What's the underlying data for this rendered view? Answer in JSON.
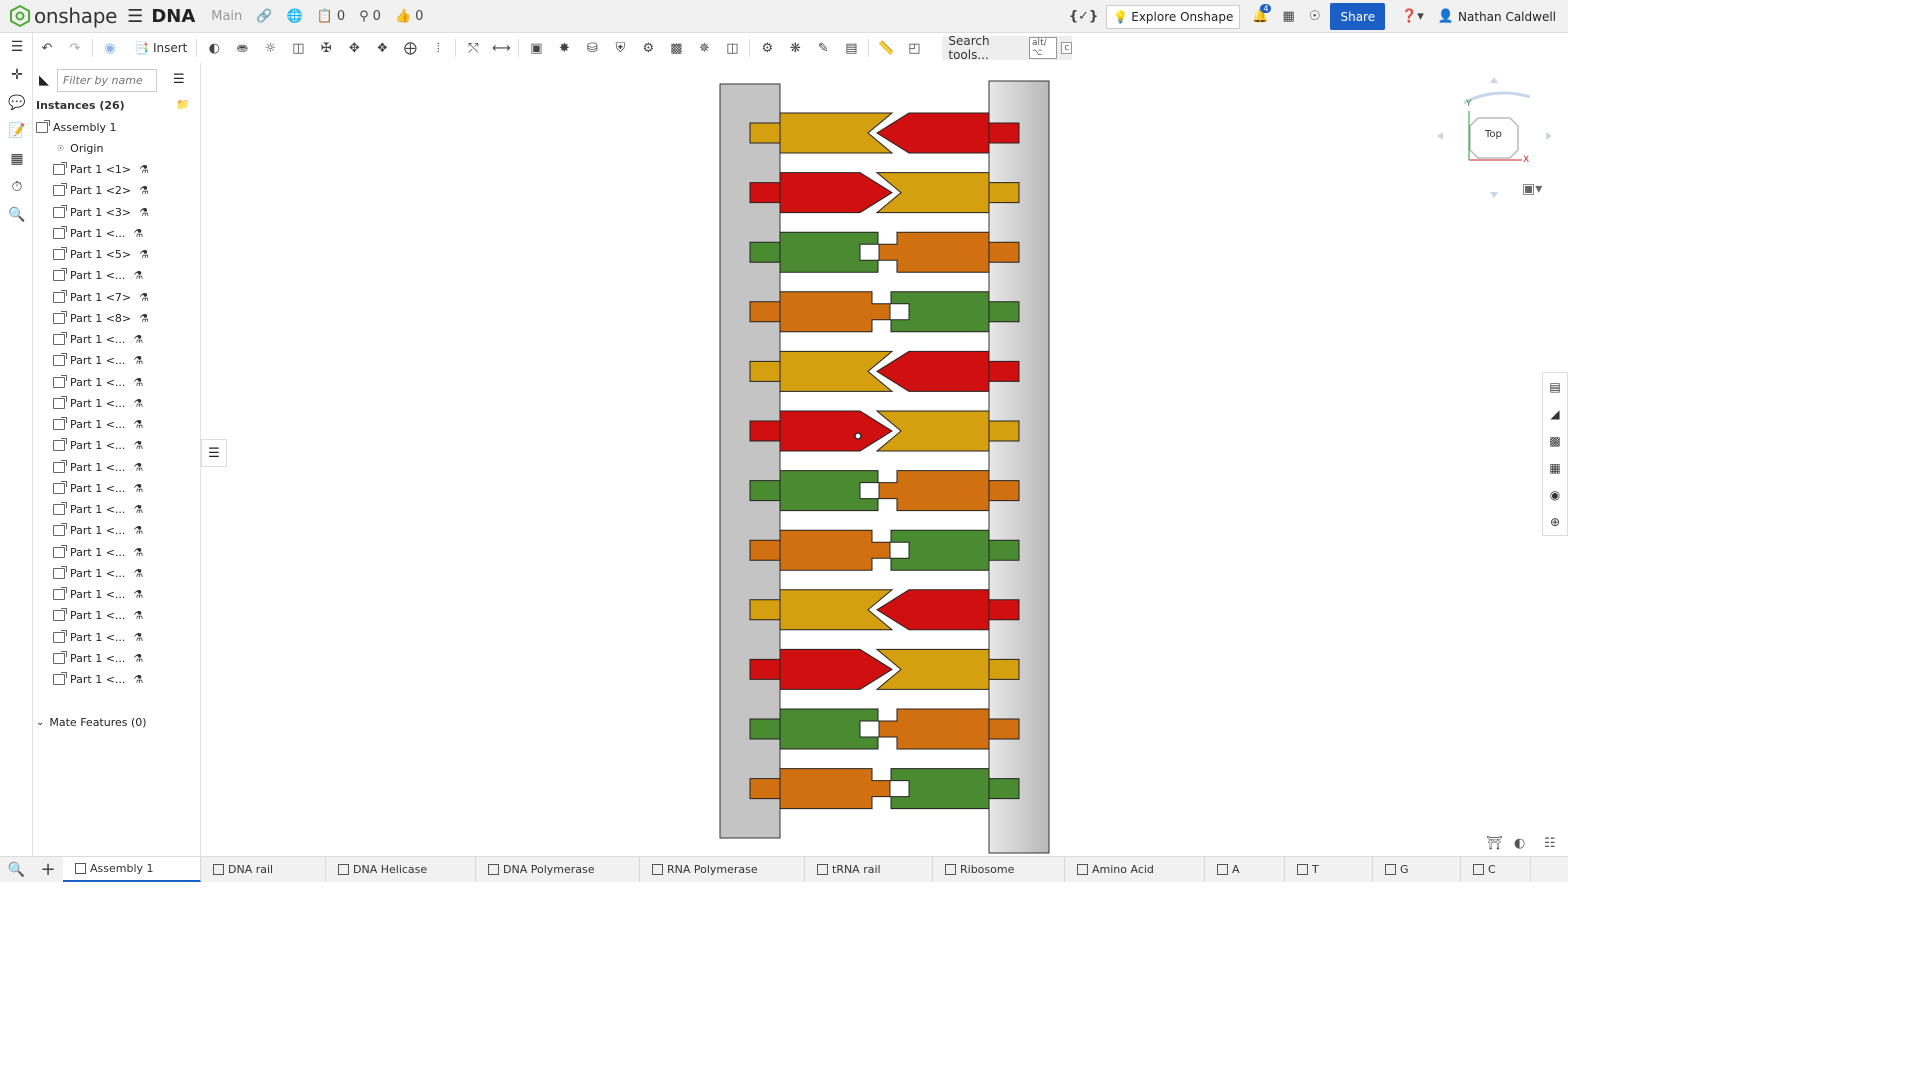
{
  "header": {
    "brand": "onshape",
    "doc_title": "DNA",
    "branch": "Main",
    "counter_docs": "0",
    "counter_versions": "0",
    "counter_likes": "0",
    "explore_label": "Explore Onshape",
    "notification_count": "4",
    "share_label": "Share",
    "user_name": "Nathan Caldwell"
  },
  "toolbar": {
    "insert_label": "Insert",
    "search_label": "Search tools...",
    "search_shortcut_a": "alt/⌥",
    "search_shortcut_b": "c"
  },
  "panel": {
    "filter_placeholder": "Filter by name",
    "instances_header": "Instances (26)",
    "assembly_label": "Assembly 1",
    "origin_label": "Origin",
    "parts": [
      "Part 1 <1>",
      "Part 1 <2>",
      "Part 1 <3>",
      "Part 1 <...",
      "Part 1 <5>",
      "Part 1 <...",
      "Part 1 <7>",
      "Part 1 <8>",
      "Part 1 <...",
      "Part 1 <...",
      "Part 1 <...",
      "Part 1 <...",
      "Part 1 <...",
      "Part 1 <...",
      "Part 1 <...",
      "Part 1 <...",
      "Part 1 <...",
      "Part 1 <...",
      "Part 1 <...",
      "Part 1 <...",
      "Part 1 <...",
      "Part 1 <...",
      "Part 1 <...",
      "Part 1 <...",
      "Part 1 <..."
    ],
    "mate_features_label": "Mate Features (0)"
  },
  "viewcube": {
    "face_label": "Top",
    "axis_x": "X",
    "axis_y": "Y"
  },
  "model": {
    "colors": {
      "rail": "#c4c4c4",
      "red": "#d01010",
      "yellow": "#d4a010",
      "green": "#4a8a30",
      "orange": "#d07010"
    },
    "left_column": [
      "yellow",
      "red",
      "green",
      "orange",
      "yellow",
      "red",
      "green",
      "orange",
      "yellow",
      "red",
      "green",
      "orange"
    ],
    "right_column": [
      "red",
      "yellow",
      "orange",
      "green",
      "red",
      "yellow",
      "orange",
      "green",
      "red",
      "yellow",
      "orange",
      "green"
    ]
  },
  "tabs": [
    {
      "label": "Assembly 1",
      "active": true
    },
    {
      "label": "DNA rail"
    },
    {
      "label": "DNA Helicase"
    },
    {
      "label": "DNA Polymerase"
    },
    {
      "label": "RNA Polymerase"
    },
    {
      "label": "tRNA rail"
    },
    {
      "label": "Ribosome"
    },
    {
      "label": "Amino Acid"
    },
    {
      "label": "A"
    },
    {
      "label": "T"
    },
    {
      "label": "G"
    },
    {
      "label": "C"
    }
  ]
}
